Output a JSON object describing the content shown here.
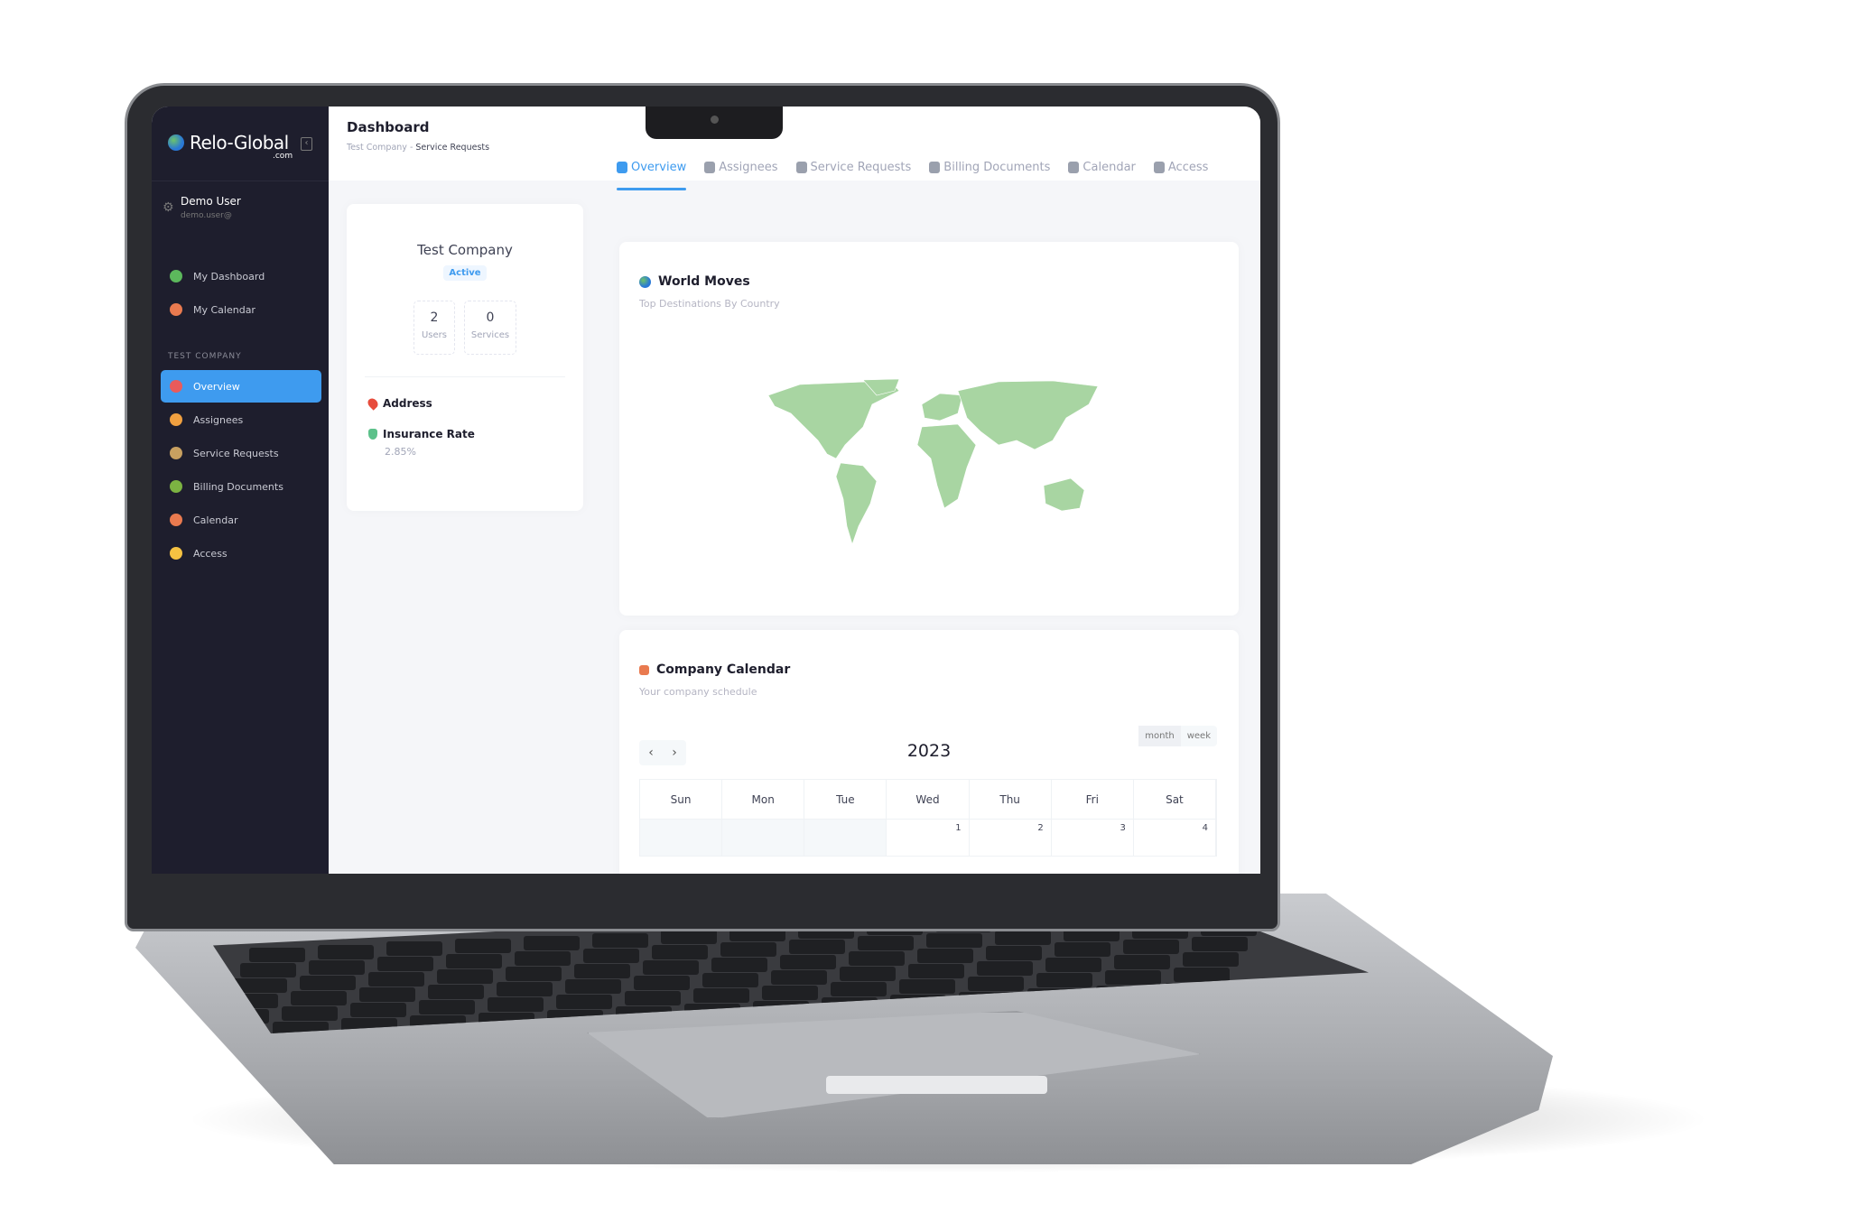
{
  "app": {
    "logo": "Relo-Global",
    "logo_suffix": ".com"
  },
  "user": {
    "name": "Demo User",
    "email": "demo.user@"
  },
  "sidebar": {
    "personal": [
      {
        "label": "My Dashboard",
        "icon": "dashboard-icon",
        "color": "#5cb85c"
      },
      {
        "label": "My Calendar",
        "icon": "calendar-icon",
        "color": "#e97a4f"
      }
    ],
    "section": "TEST COMPANY",
    "items": [
      {
        "label": "Overview",
        "icon": "overview-icon",
        "color": "#e95b5b",
        "active": true
      },
      {
        "label": "Assignees",
        "icon": "assignees-icon",
        "color": "#f0a040"
      },
      {
        "label": "Service Requests",
        "icon": "service-requests-icon",
        "color": "#c8a060"
      },
      {
        "label": "Billing Documents",
        "icon": "billing-documents-icon",
        "color": "#7cb342"
      },
      {
        "label": "Calendar",
        "icon": "calendar-icon",
        "color": "#e97a4f"
      },
      {
        "label": "Access",
        "icon": "access-icon",
        "color": "#f5c242"
      }
    ]
  },
  "header": {
    "title": "Dashboard",
    "breadcrumb": [
      "Test Company",
      "Service Requests"
    ]
  },
  "company": {
    "name": "Test Company",
    "status": "Active",
    "stats": [
      {
        "value": "2",
        "label": "Users"
      },
      {
        "value": "0",
        "label": "Services"
      }
    ],
    "address_label": "Address",
    "insurance_label": "Insurance Rate",
    "insurance_value": "2.85%"
  },
  "tabs": [
    {
      "label": "Overview",
      "active": true
    },
    {
      "label": "Assignees"
    },
    {
      "label": "Service Requests"
    },
    {
      "label": "Billing Documents"
    },
    {
      "label": "Calendar"
    },
    {
      "label": "Access"
    }
  ],
  "world_moves": {
    "title": "World Moves",
    "subtitle": "Top Destinations By Country",
    "map_color": "#a8d5a2"
  },
  "calendar": {
    "title": "Company Calendar",
    "subtitle": "Your company schedule",
    "year": "2023",
    "views": [
      "month",
      "week"
    ],
    "days": [
      "Sun",
      "Mon",
      "Tue",
      "Wed",
      "Thu",
      "Fri",
      "Sat"
    ],
    "first_week": [
      "",
      "",
      "",
      "1",
      "2",
      "3",
      "4"
    ]
  },
  "colors": {
    "accent": "#3e9bef",
    "sidebar_bg": "#1e1e2d"
  }
}
